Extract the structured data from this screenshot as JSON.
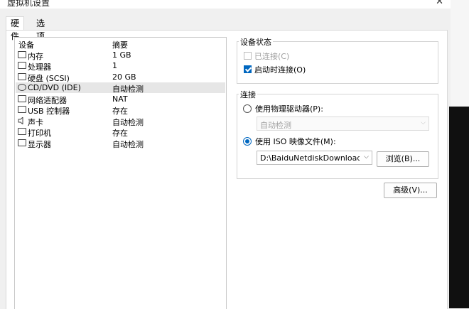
{
  "window": {
    "title": "虚拟机设置",
    "close_glyph": "✕"
  },
  "tabs": [
    {
      "label": "硬件",
      "active": true
    },
    {
      "label": "选项",
      "active": false
    }
  ],
  "device_list": {
    "columns": {
      "device": "设备",
      "summary": "摘要"
    },
    "rows": [
      {
        "name": "内存",
        "summary": "1 GB",
        "icon": "memory-icon"
      },
      {
        "name": "处理器",
        "summary": "1",
        "icon": "processor-icon"
      },
      {
        "name": "硬盘 (SCSI)",
        "summary": "20 GB",
        "icon": "harddisk-icon"
      },
      {
        "name": "CD/DVD (IDE)",
        "summary": "自动检测",
        "icon": "cd-dvd-icon",
        "selected": true
      },
      {
        "name": "网络适配器",
        "summary": "NAT",
        "icon": "network-adapter-icon"
      },
      {
        "name": "USB 控制器",
        "summary": "存在",
        "icon": "usb-icon"
      },
      {
        "name": "声卡",
        "summary": "自动检测",
        "icon": "sound-card-icon"
      },
      {
        "name": "打印机",
        "summary": "存在",
        "icon": "printer-icon"
      },
      {
        "name": "显示器",
        "summary": "自动检测",
        "icon": "display-icon"
      }
    ]
  },
  "device_status": {
    "title": "设备状态",
    "connected": {
      "label": "已连接(C)",
      "checked": false,
      "disabled": true
    },
    "connect_at_power_on": {
      "label": "启动时连接(O)",
      "checked": true
    }
  },
  "connection": {
    "title": "连接",
    "physical_drive": {
      "label": "使用物理驱动器(P):",
      "selected": false
    },
    "physical_drive_value": "自动检测",
    "iso_image": {
      "label": "使用 ISO 映像文件(M):",
      "selected": true
    },
    "iso_path": "D:\\BaiduNetdiskDownload\\hac",
    "browse_label": "浏览(B)..."
  },
  "advanced_label": "高级(V)...",
  "colors": {
    "accent": "#0067c0",
    "selected_row": "#e6e6e6"
  }
}
